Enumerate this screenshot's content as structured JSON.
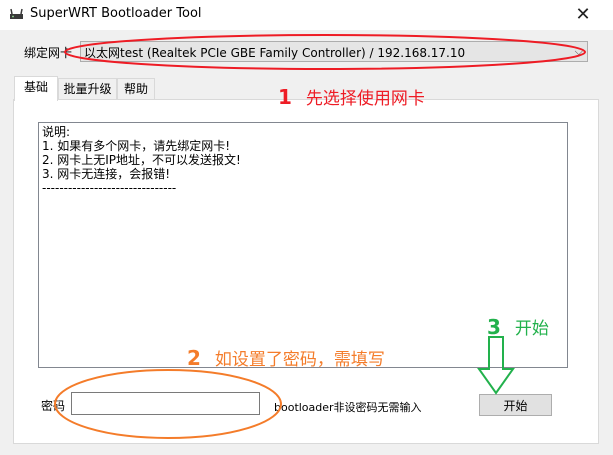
{
  "window": {
    "title": "SuperWRT Bootloader Tool",
    "close_glyph": "✕"
  },
  "nic": {
    "label": "绑定网卡",
    "selected_value": "以太网test (Realtek PCIe GBE Family Controller) / 192.168.17.10"
  },
  "tabs": [
    {
      "label": "基础",
      "active": true
    },
    {
      "label": "批量升级",
      "active": false
    },
    {
      "label": "帮助",
      "active": false
    }
  ],
  "info_text": "说明:\n1. 如果有多个网卡，请先绑定网卡!\n2. 网卡上无IP地址，不可以发送报文!\n3. 网卡无连接，会报错!\n-------------------------------",
  "password": {
    "label": "密码",
    "value": "",
    "hint": "bootloader非设密码无需输入"
  },
  "start_button": {
    "label": "开始"
  },
  "annotations": [
    {
      "number": "1",
      "text": "先选择使用网卡",
      "color": "#ee1c25"
    },
    {
      "number": "2",
      "text": "如设置了密码，需填写",
      "color": "#f47c2a"
    },
    {
      "number": "3",
      "text": "开始",
      "color": "#22b14c"
    }
  ],
  "icons": {
    "app": "router-icon",
    "close": "close-icon",
    "dropdown": "chevron-down-icon"
  }
}
